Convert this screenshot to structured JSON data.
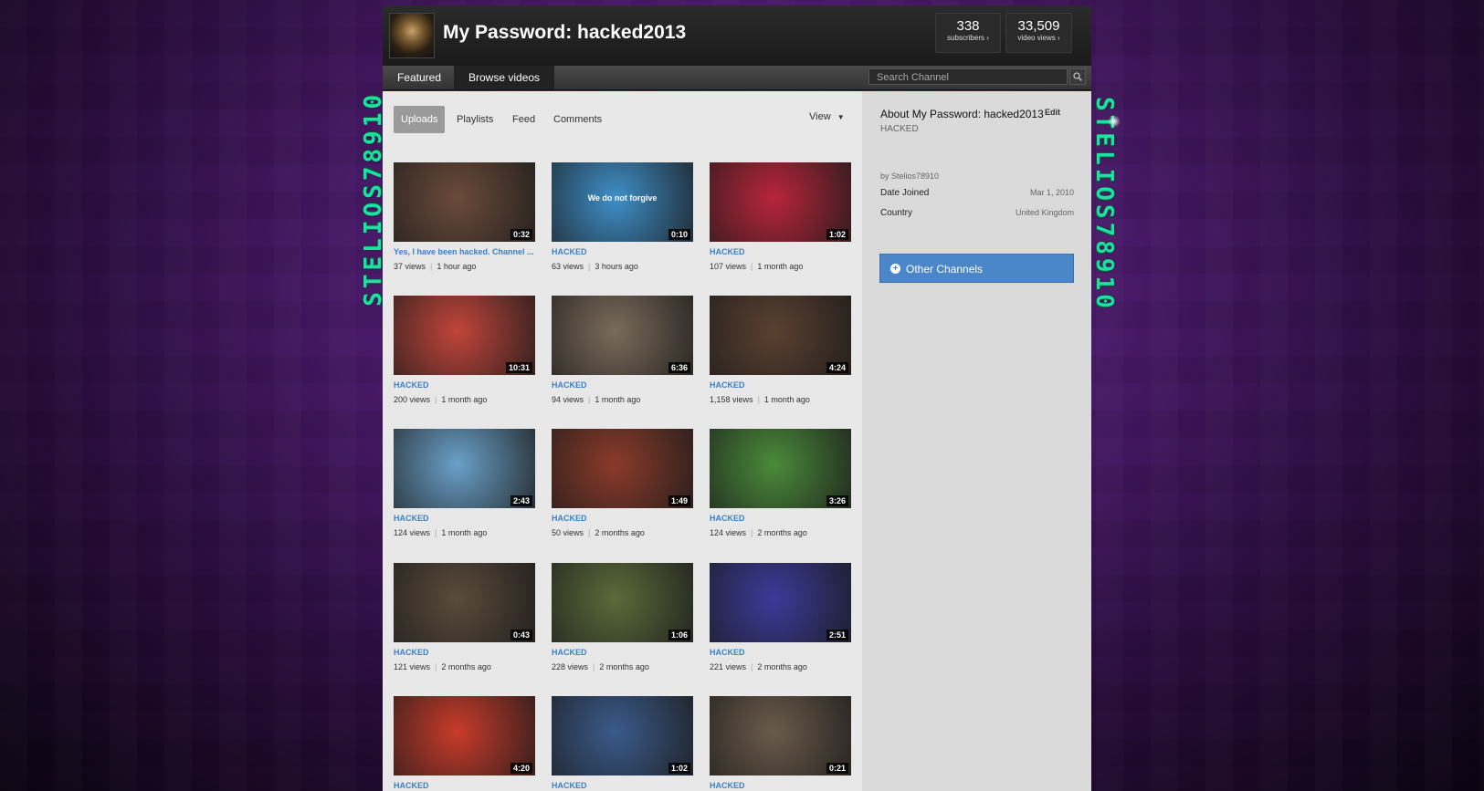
{
  "channel": {
    "title": "My Password: hacked2013",
    "subscribers_count": "338",
    "subscribers_label": "subscribers ›",
    "views_count": "33,509",
    "views_label": "video views ›"
  },
  "side_text": "STELIOS78910",
  "nav": {
    "featured_label": "Featured",
    "browse_label": "Browse videos",
    "search_placeholder": "Search Channel"
  },
  "subtabs": {
    "uploads": "Uploads",
    "playlists": "Playlists",
    "feed": "Feed",
    "comments": "Comments",
    "view": "View"
  },
  "videos": [
    {
      "title": "Yes, I have been hacked. Channel ...",
      "views": "37 views",
      "age": "1 hour ago",
      "duration": "0:32",
      "color": "#6b4a3a"
    },
    {
      "title": "HACKED",
      "views": "63 views",
      "age": "3 hours ago",
      "duration": "0:10",
      "color": "#3f8fc9",
      "overlay": "We do not forgive"
    },
    {
      "title": "HACKED",
      "views": "107 views",
      "age": "1 month ago",
      "duration": "1:02",
      "color": "#b8243a"
    },
    {
      "title": "HACKED",
      "views": "200 views",
      "age": "1 month ago",
      "duration": "10:31",
      "color": "#c0443a"
    },
    {
      "title": "HACKED",
      "views": "94 views",
      "age": "1 month ago",
      "duration": "6:36",
      "color": "#7a6a5a"
    },
    {
      "title": "HACKED",
      "views": "1,158 views",
      "age": "1 month ago",
      "duration": "4:24",
      "color": "#5a4030"
    },
    {
      "title": "HACKED",
      "views": "124 views",
      "age": "1 month ago",
      "duration": "2:43",
      "color": "#6aa0c8"
    },
    {
      "title": "HACKED",
      "views": "50 views",
      "age": "2 months ago",
      "duration": "1:49",
      "color": "#8a3a2a"
    },
    {
      "title": "HACKED",
      "views": "124 views",
      "age": "2 months ago",
      "duration": "3:26",
      "color": "#4a8a3a"
    },
    {
      "title": "HACKED",
      "views": "121 views",
      "age": "2 months ago",
      "duration": "0:43",
      "color": "#5a4a3a"
    },
    {
      "title": "HACKED",
      "views": "228 views",
      "age": "2 months ago",
      "duration": "1:06",
      "color": "#5a6a3a"
    },
    {
      "title": "HACKED",
      "views": "221 views",
      "age": "2 months ago",
      "duration": "2:51",
      "color": "#3a3a9a"
    },
    {
      "title": "HACKED",
      "views": "",
      "age": "",
      "duration": "4:20",
      "color": "#c83a2a"
    },
    {
      "title": "HACKED",
      "views": "",
      "age": "",
      "duration": "1:02",
      "color": "#3a5a8a"
    },
    {
      "title": "HACKED",
      "views": "",
      "age": "",
      "duration": "0:21",
      "color": "#6a5a4a"
    }
  ],
  "about": {
    "title": "About My Password: hacked2013",
    "edit": "Edit",
    "description": "HACKED",
    "by": "by Stelios78910",
    "date_joined_label": "Date Joined",
    "date_joined_value": "Mar 1, 2010",
    "country_label": "Country",
    "country_value": "United Kingdom",
    "other_channels": "Other Channels"
  }
}
